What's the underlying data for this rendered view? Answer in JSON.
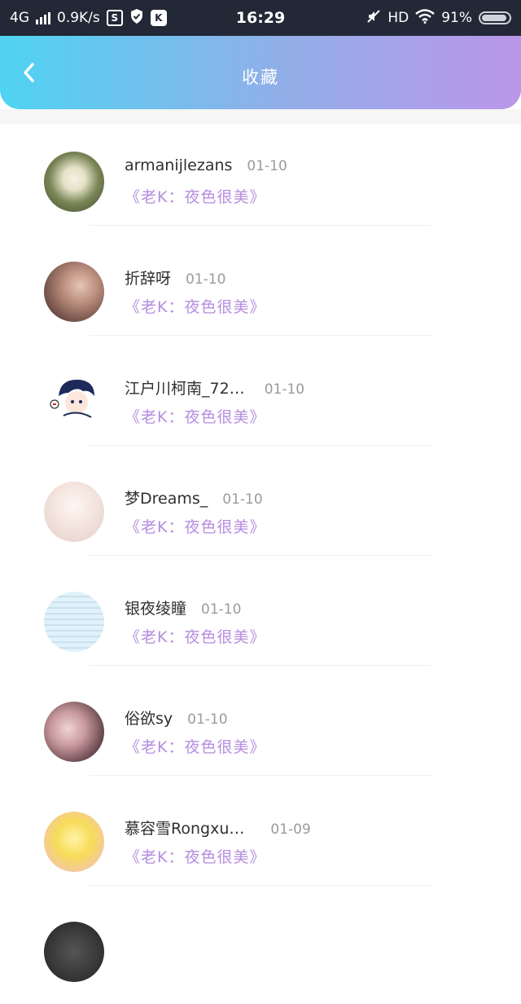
{
  "status_bar": {
    "network": "4G",
    "speed": "0.9K/s",
    "s_icon_label": "S",
    "k_icon_label": "K",
    "time": "16:29",
    "hd": "HD",
    "battery": "91%"
  },
  "header": {
    "title": "收藏",
    "back_icon": "chevron-left-icon"
  },
  "colors": {
    "gradient_start": "#4fd3f1",
    "gradient_end": "#bb96e9",
    "subtitle": "#b58de0",
    "status_bar_bg": "#222836"
  },
  "list": {
    "items": [
      {
        "name": "armanijlezans",
        "date": "01-10",
        "subtitle": "《老K：夜色很美》"
      },
      {
        "name": "折辞呀",
        "date": "01-10",
        "subtitle": "《老K：夜色很美》"
      },
      {
        "name": "江户川柯南_72…",
        "date": "01-10",
        "subtitle": "《老K：夜色很美》"
      },
      {
        "name": "梦Dreams_",
        "date": "01-10",
        "subtitle": "《老K：夜色很美》"
      },
      {
        "name": "银夜绫瞳",
        "date": "01-10",
        "subtitle": "《老K：夜色很美》"
      },
      {
        "name": "俗欲sy",
        "date": "01-10",
        "subtitle": "《老K：夜色很美》"
      },
      {
        "name": "慕容雪Rongxu…",
        "date": "01-09",
        "subtitle": "《老K：夜色很美》"
      }
    ]
  }
}
